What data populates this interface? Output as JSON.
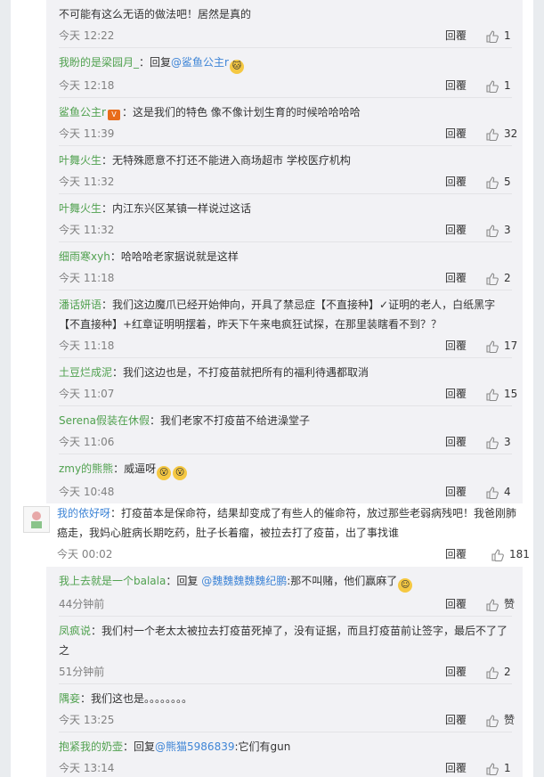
{
  "reply_label": "回覆",
  "sub1": [
    {
      "name": "",
      "body": "不可能有这么无语的做法吧！居然是真的",
      "time": "今天 12:22",
      "likes": "1"
    },
    {
      "name": "我盼的是梁园月_",
      "prefix": "：回复",
      "at": "@鲨鱼公主r",
      "body": "",
      "time": "今天 12:18",
      "likes": "1",
      "badge": "cat"
    },
    {
      "name": "鲨鱼公主r",
      "body": "：这是我们的特色 像不像计划生育的时候哈哈哈哈",
      "time": "今天 11:39",
      "likes": "32",
      "vip": true
    },
    {
      "name": "叶舞火生",
      "body": "：无特殊愿意不打还不能进入商场超市 学校医疗机构",
      "time": "今天 11:32",
      "likes": "5"
    },
    {
      "name": "叶舞火生",
      "body": "：内江东兴区某镇一样说过这话",
      "time": "今天 11:32",
      "likes": "3"
    },
    {
      "name": "细雨寒xyh",
      "body": "：哈哈哈老家据说就是这样",
      "time": "今天 11:18",
      "likes": "2"
    },
    {
      "name": "潘话妍语",
      "body": "：我们这边魔爪已经开始伸向，开具了禁忌症【不直接种】✓证明的老人，白纸黑字【不直接种】+红章证明明摆着，昨天下午来电疯狂试探，在那里装瞎看不到？？",
      "time": "今天 11:18",
      "likes": "17"
    },
    {
      "name": "土豆烂成泥",
      "body": "：我们这边也是，不打疫苗就把所有的福利待遇都取消",
      "time": "今天 11:07",
      "likes": "15"
    },
    {
      "name": "Serena假装在休假",
      "body": "：我们老家不打疫苗不给进澡堂子",
      "time": "今天 11:06",
      "likes": "3"
    },
    {
      "name": "zmy的熊熊",
      "body": "：威逼呀",
      "time": "今天 10:48",
      "likes": "4",
      "emoji2": true
    }
  ],
  "top": {
    "name": "我的依好呀",
    "body": "：打疫苗本是保命符，结果却变成了有些人的催命符，放过那些老弱病残吧！我爸刚肺癌走，我妈心脏病长期吃药，肚子长着瘤，被拉去打了疫苗，出了事找谁",
    "time": "今天 00:02",
    "likes": "181"
  },
  "sub2": [
    {
      "name": "我上去就是一个balala",
      "prefix": "：回复 ",
      "at": "@魏魏魏魏魏纪鹏",
      "body": ":那不叫赌，他们赢麻了",
      "time": "44分钟前",
      "likes": "赞",
      "smile": true
    },
    {
      "name": "凤疯说",
      "body": "：我们村一个老太太被拉去打疫苗死掉了，没有证据，而且打疫苗前让签字，最后不了了之",
      "time": "51分钟前",
      "likes": "2"
    },
    {
      "name": "隅妾",
      "body": "：我们这也是。。。。。。。。",
      "time": "今天 13:25",
      "likes": "赞"
    },
    {
      "name": "抱紧我的奶壶",
      "prefix": "：回复",
      "at": "@熊猫5986839",
      "body": ":它们有gun",
      "time": "今天 13:14",
      "likes": "1"
    }
  ]
}
